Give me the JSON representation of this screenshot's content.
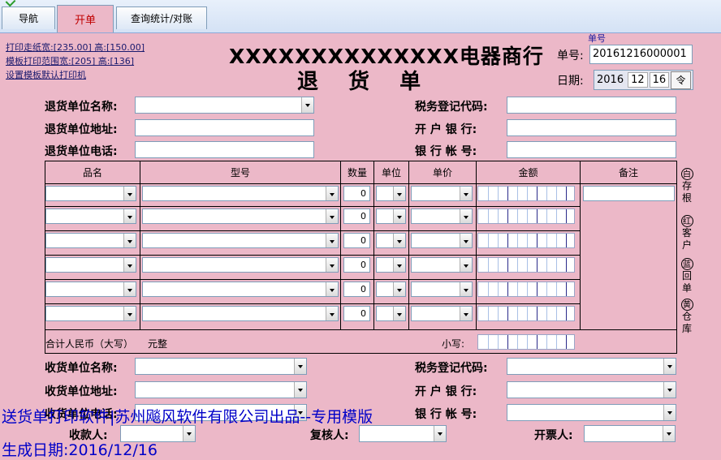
{
  "tabs": [
    {
      "label": "导航"
    },
    {
      "label": "开单"
    },
    {
      "label": "查询统计/对账"
    }
  ],
  "print_links": [
    "打印走纸宽:[235.00] 高:[150.00]",
    "模板打印范围宽:[205] 高:[136]",
    "设置模板默认打印机"
  ],
  "header": {
    "company": "XXXXXXXXXXXXXX电器商行",
    "doc_title": "退 货 单",
    "no_label": "单号:",
    "no_value": "20161216000001",
    "no_hint": "单号",
    "date_label": "日期:",
    "date_year": "2016",
    "date_month": "12",
    "date_day": "16",
    "date_spin": "令"
  },
  "returner": {
    "name_label": "退货单位名称:",
    "address_label": "退货单位地址:",
    "phone_label": "退货单位电话:",
    "tax_label": "税务登记代码:",
    "bank_label": "开 户  银 行:",
    "account_label": "银 行  帐 号:"
  },
  "table": {
    "headers": [
      "品名",
      "型号",
      "数量",
      "单位",
      "单价",
      "金额",
      "备注"
    ],
    "rows": [
      {
        "qty": "0"
      },
      {
        "qty": "0"
      },
      {
        "qty": "0"
      },
      {
        "qty": "0"
      },
      {
        "qty": "0"
      },
      {
        "qty": "0"
      }
    ],
    "total_rmb_label": "合计人民币（大写）",
    "total_rmb_suffix": "元整",
    "small_label": "小写:"
  },
  "side_labels": [
    {
      "circle": "白",
      "text": [
        "存",
        "根"
      ]
    },
    {
      "circle": "红",
      "text": [
        "客",
        "户"
      ]
    },
    {
      "circle": "蓝",
      "text": [
        "回",
        "单"
      ]
    },
    {
      "circle": "黄",
      "text": [
        "仓",
        "库"
      ]
    }
  ],
  "receiver": {
    "name_label": "收货单位名称:",
    "address_label": "收货单位地址:",
    "phone_label": "收货单位电话:",
    "tax_label": "税务登记代码:",
    "bank_label": "开 户  银 行:",
    "account_label": "银 行  帐 号:"
  },
  "signers": {
    "payee_label": "收款人:",
    "reviewer_label": "复核人:",
    "issuer_label": "开票人:"
  },
  "watermark": {
    "line1": "送货单打印软件|苏州飚风软件有限公司出品--专用模版",
    "line2": "生成日期:2016/12/16"
  }
}
